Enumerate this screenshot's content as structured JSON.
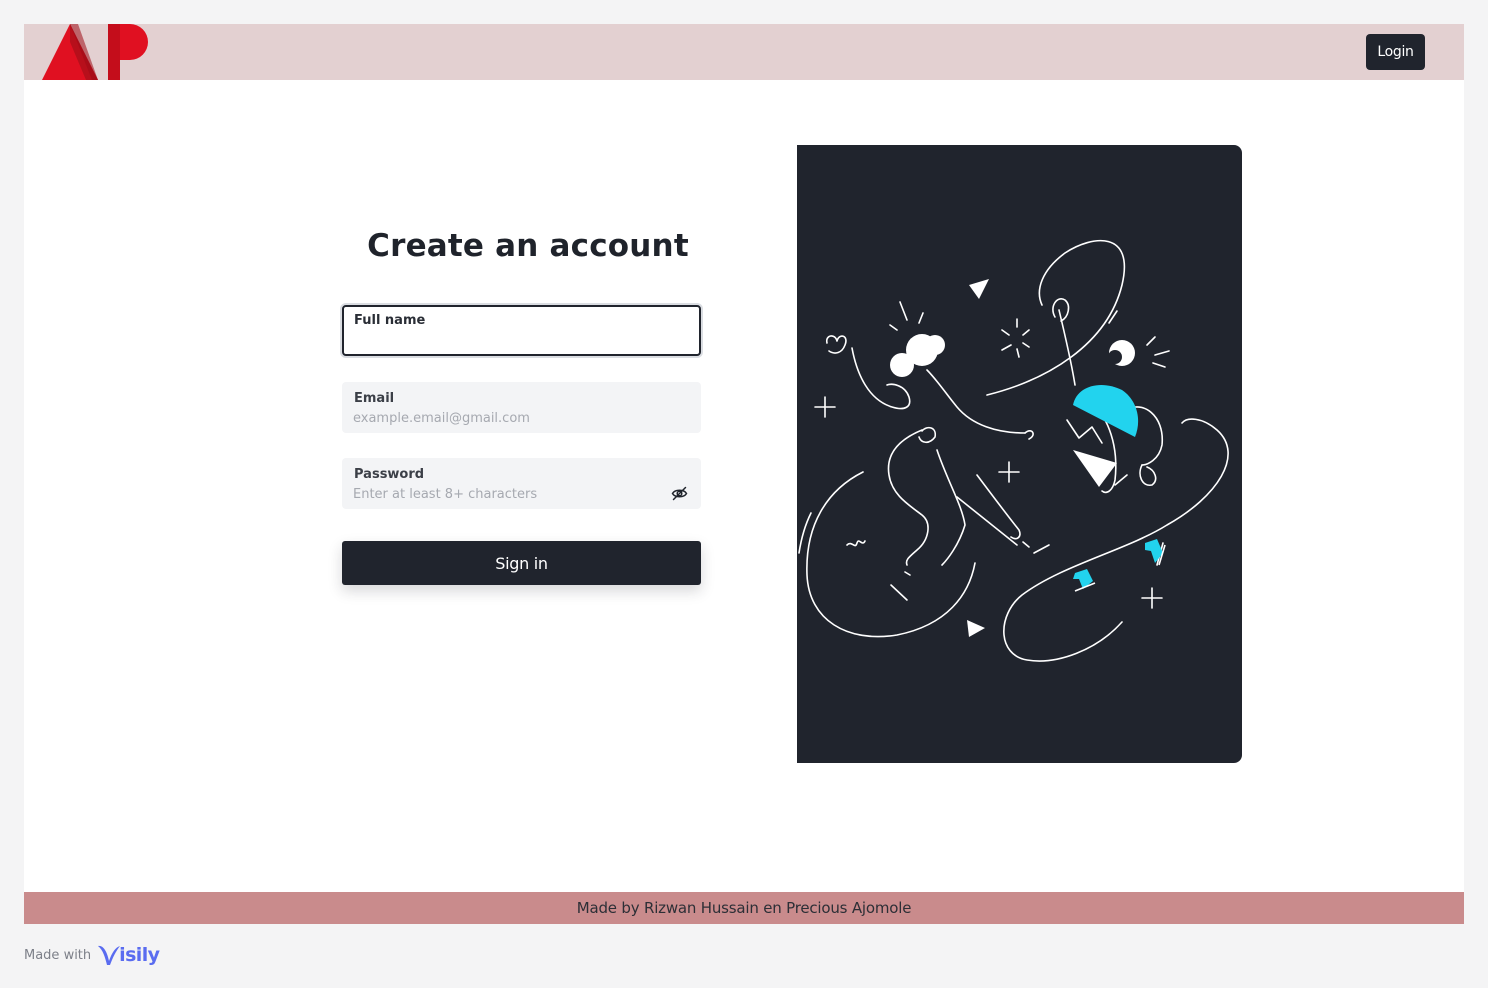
{
  "header": {
    "logo_text": "AP",
    "login_label": "Login"
  },
  "form": {
    "title": "Create an account",
    "full_name": {
      "label": "Full name",
      "value": "",
      "placeholder": ""
    },
    "email": {
      "label": "Email",
      "value": "",
      "placeholder": "example.email@gmail.com"
    },
    "password": {
      "label": "Password",
      "value": "",
      "placeholder": "Enter at least 8+ characters",
      "toggle_icon": "eye-off-icon"
    },
    "submit_label": "Sign in"
  },
  "illustration": {
    "icon": "people-jumping-illustration",
    "accent_color": "#22d3ee",
    "background_color": "#20242d"
  },
  "footer": {
    "text": "Made by Rizwan Hussain en Precious Ajomole"
  },
  "badge": {
    "prefix": "Made with",
    "brand": "isily"
  },
  "colors": {
    "primary": "#20242d",
    "header_bg": "#e3d0d1",
    "footer_bg": "#c98b8c",
    "logo_red": "#e01021",
    "brand_blue": "#5a6cf0"
  }
}
